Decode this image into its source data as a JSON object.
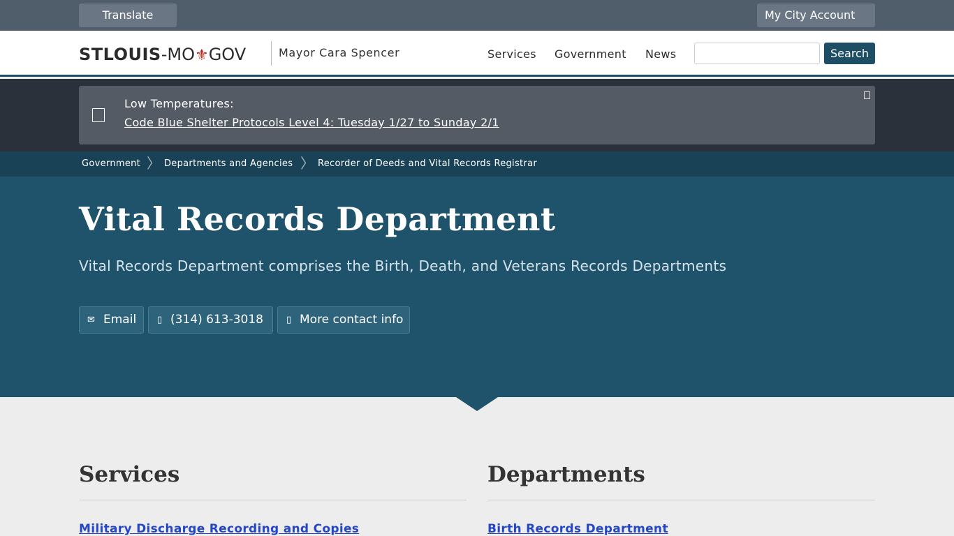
{
  "topbar": {
    "translate_label": "Translate",
    "account_label": "My City Account"
  },
  "header": {
    "logo_bold": "STLOUIS",
    "logo_dash": "-MO",
    "logo_fleur": "⚜",
    "logo_gov": "GOV",
    "mayor": "Mayor Cara Spencer",
    "nav": [
      "Services",
      "Government",
      "News"
    ],
    "search_placeholder": "",
    "search_label": "Search"
  },
  "alert": {
    "title": "Low Temperatures:",
    "link": "Code Blue Shelter Protocols Level 4: Tuesday 1/27 to Sunday 2/1"
  },
  "breadcrumb": [
    "Government",
    "Departments and Agencies",
    "Recorder of Deeds and Vital Records Registrar"
  ],
  "hero": {
    "title": "Vital Records Department",
    "subtitle": "Vital Records Department comprises the Birth, Death, and Veterans Records Departments",
    "contacts": [
      {
        "icon": "envelope-icon",
        "label": "Email"
      },
      {
        "icon": "phone-icon",
        "label": "(314) 613-3018"
      },
      {
        "icon": "info-icon",
        "label": "More contact info"
      }
    ]
  },
  "sections": {
    "services": {
      "title": "Services",
      "first_link": "Military Discharge Recording and Copies"
    },
    "departments": {
      "title": "Departments",
      "first_link": "Birth Records Department"
    }
  }
}
